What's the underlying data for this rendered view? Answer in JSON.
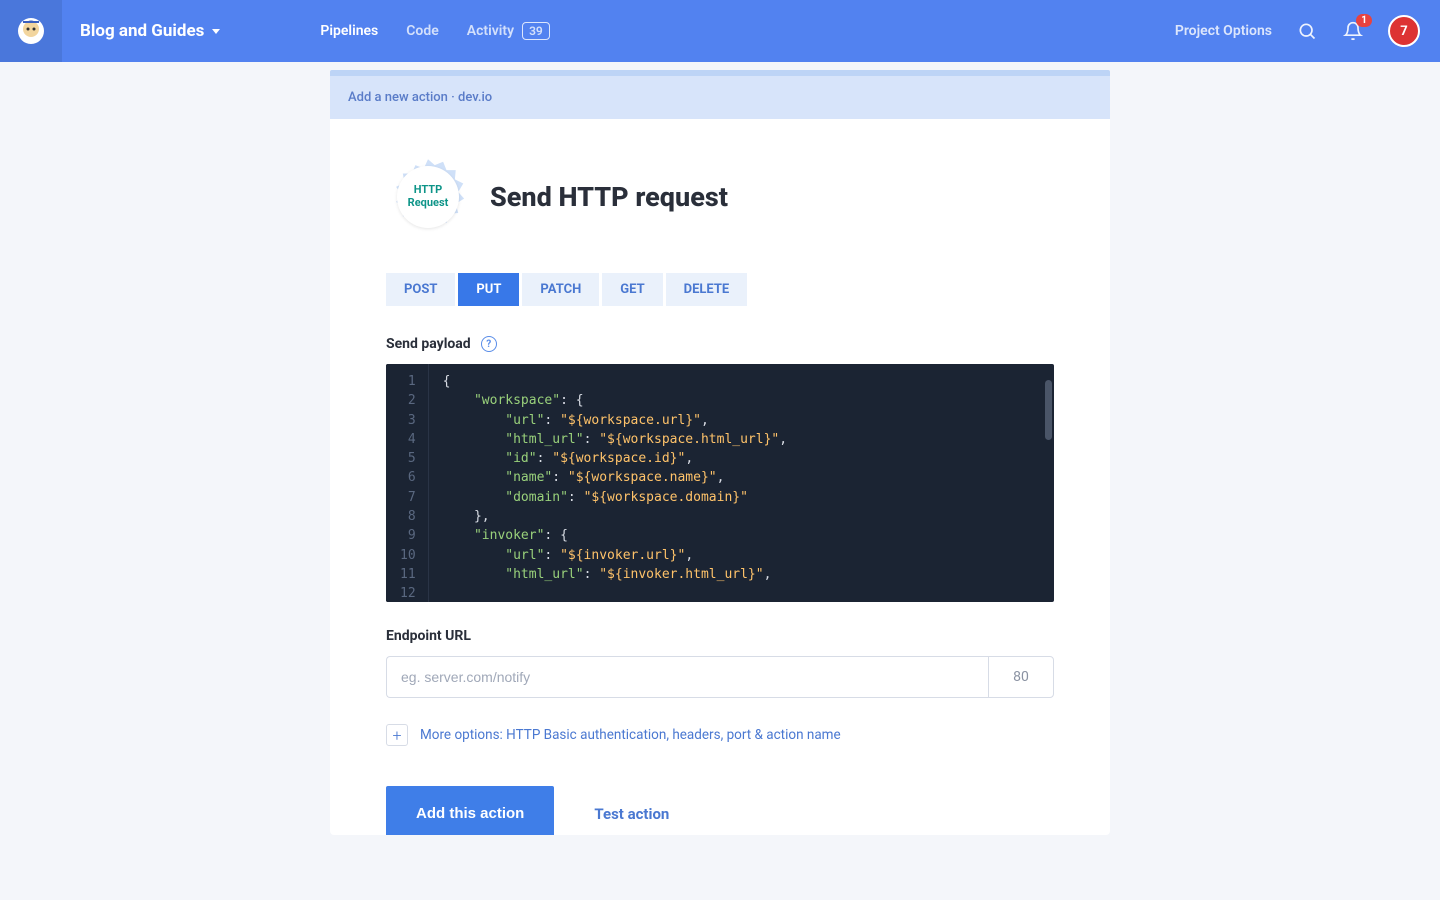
{
  "header": {
    "project_name": "Blog and Guides",
    "nav": {
      "pipelines": "Pipelines",
      "code": "Code",
      "activity": "Activity",
      "activity_count": "39"
    },
    "project_options": "Project Options",
    "notif_count": "1",
    "avatar_text": "7"
  },
  "breadcrumb": "Add a new action · dev.io",
  "page": {
    "icon_line1": "HTTP",
    "icon_line2": "Request",
    "title": "Send HTTP request"
  },
  "methods": [
    "POST",
    "PUT",
    "PATCH",
    "GET",
    "DELETE"
  ],
  "active_method": "PUT",
  "payload": {
    "label": "Send payload",
    "lines": [
      {
        "n": "1",
        "indent": 0,
        "tokens": [
          {
            "t": "punc",
            "v": "{"
          }
        ]
      },
      {
        "n": "2",
        "indent": 1,
        "tokens": [
          {
            "t": "key",
            "v": "\"workspace\""
          },
          {
            "t": "punc",
            "v": ": {"
          }
        ]
      },
      {
        "n": "3",
        "indent": 2,
        "tokens": [
          {
            "t": "key",
            "v": "\"url\""
          },
          {
            "t": "punc",
            "v": ": "
          },
          {
            "t": "str",
            "v": "\"${workspace.url}\""
          },
          {
            "t": "punc",
            "v": ","
          }
        ]
      },
      {
        "n": "4",
        "indent": 2,
        "tokens": [
          {
            "t": "key",
            "v": "\"html_url\""
          },
          {
            "t": "punc",
            "v": ": "
          },
          {
            "t": "str",
            "v": "\"${workspace.html_url}\""
          },
          {
            "t": "punc",
            "v": ","
          }
        ]
      },
      {
        "n": "5",
        "indent": 2,
        "tokens": [
          {
            "t": "key",
            "v": "\"id\""
          },
          {
            "t": "punc",
            "v": ": "
          },
          {
            "t": "str",
            "v": "\"${workspace.id}\""
          },
          {
            "t": "punc",
            "v": ","
          }
        ]
      },
      {
        "n": "6",
        "indent": 2,
        "tokens": [
          {
            "t": "key",
            "v": "\"name\""
          },
          {
            "t": "punc",
            "v": ": "
          },
          {
            "t": "str",
            "v": "\"${workspace.name}\""
          },
          {
            "t": "punc",
            "v": ","
          }
        ]
      },
      {
        "n": "7",
        "indent": 2,
        "tokens": [
          {
            "t": "key",
            "v": "\"domain\""
          },
          {
            "t": "punc",
            "v": ": "
          },
          {
            "t": "str",
            "v": "\"${workspace.domain}\""
          }
        ]
      },
      {
        "n": "8",
        "indent": 1,
        "tokens": [
          {
            "t": "punc",
            "v": "},"
          }
        ]
      },
      {
        "n": "9",
        "indent": 1,
        "tokens": [
          {
            "t": "key",
            "v": "\"invoker\""
          },
          {
            "t": "punc",
            "v": ": {"
          }
        ]
      },
      {
        "n": "10",
        "indent": 2,
        "tokens": [
          {
            "t": "key",
            "v": "\"url\""
          },
          {
            "t": "punc",
            "v": ": "
          },
          {
            "t": "str",
            "v": "\"${invoker.url}\""
          },
          {
            "t": "punc",
            "v": ","
          }
        ]
      },
      {
        "n": "11",
        "indent": 2,
        "tokens": [
          {
            "t": "key",
            "v": "\"html_url\""
          },
          {
            "t": "punc",
            "v": ": "
          },
          {
            "t": "str",
            "v": "\"${invoker.html_url}\""
          },
          {
            "t": "punc",
            "v": ","
          }
        ]
      },
      {
        "n": "12",
        "indent": 2,
        "tokens": []
      }
    ]
  },
  "endpoint": {
    "label": "Endpoint URL",
    "placeholder": "eg. server.com/notify",
    "port": "80"
  },
  "more_options": "More options: HTTP Basic authentication, headers, port & action name",
  "actions": {
    "primary": "Add this action",
    "secondary": "Test action"
  }
}
